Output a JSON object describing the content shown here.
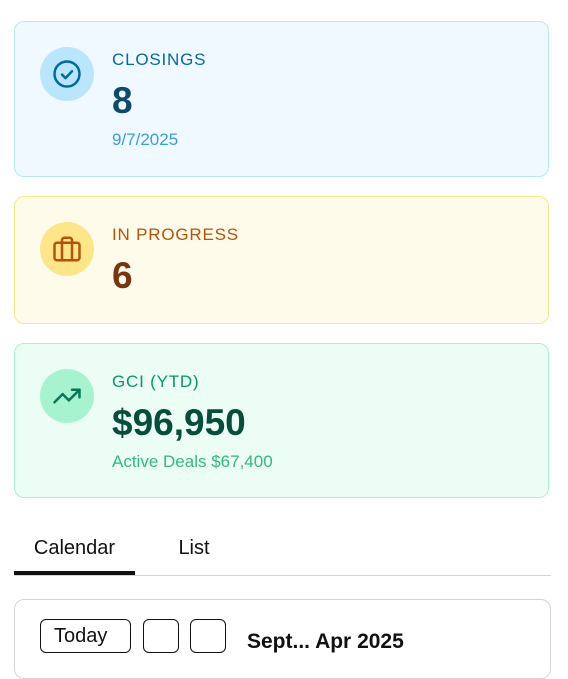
{
  "cards": {
    "closings": {
      "icon": "check-circle-icon",
      "label": "CLOSINGS",
      "value": "8",
      "sub": "9/7/2025"
    },
    "in_progress": {
      "icon": "briefcase-icon",
      "label": "IN PROGRESS",
      "value": "6"
    },
    "gci": {
      "icon": "trending-up-icon",
      "label": "GCI (YTD)",
      "value": "$96,950",
      "sub": "Active Deals $67,400"
    }
  },
  "tabs": [
    {
      "label": "Calendar",
      "active": true
    },
    {
      "label": "List",
      "active": false
    }
  ],
  "calendar": {
    "today_label": "Today",
    "month_title": "Sept... Apr 2025"
  },
  "colors": {
    "closings_accent": "#0369a1",
    "in_progress_accent": "#b45309",
    "gci_accent": "#059669",
    "tab_active": "#111111"
  }
}
